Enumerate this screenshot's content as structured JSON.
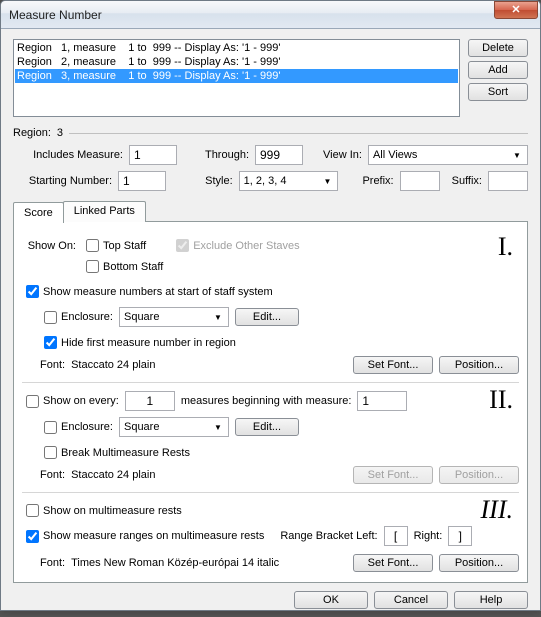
{
  "title": "Measure Number",
  "buttons": {
    "delete": "Delete",
    "add": "Add",
    "sort": "Sort",
    "ok": "OK",
    "cancel": "Cancel",
    "help": "Help",
    "edit": "Edit...",
    "setfont": "Set Font...",
    "position": "Position..."
  },
  "list": {
    "rows": [
      "Region   1, measure    1 to  999 -- Display As: '1 - 999'",
      "Region   2, measure    1 to  999 -- Display As: '1 - 999'",
      "Region   3, measure    1 to  999 -- Display As: '1 - 999'"
    ],
    "selected": 2
  },
  "region": {
    "label": "Region:",
    "value": "3"
  },
  "labels": {
    "includes": "Includes Measure:",
    "through": "Through:",
    "viewin": "View In:",
    "starting": "Starting Number:",
    "style": "Style:",
    "prefix": "Prefix:",
    "suffix": "Suffix:"
  },
  "values": {
    "includes": "1",
    "through": "999",
    "viewin": "All Views",
    "starting": "1",
    "style": "1, 2, 3, 4",
    "prefix": "",
    "suffix": ""
  },
  "tabs": {
    "score": "Score",
    "linked": "Linked Parts"
  },
  "sec1": {
    "showon": "Show On:",
    "topstaff": "Top Staff",
    "bottomstaff": "Bottom Staff",
    "exclude": "Exclude Other Staves",
    "showmeasures": "Show measure numbers at start of staff system",
    "enclosure": "Enclosure:",
    "enclosure_val": "Square",
    "hidefirst": "Hide first measure number in region",
    "font": "Font:",
    "fontval": "Staccato 24 plain",
    "preview": "I."
  },
  "sec2": {
    "showevery": "Show on every:",
    "every_val": "1",
    "measures_begin": "measures beginning with measure:",
    "begin_val": "1",
    "enclosure": "Enclosure:",
    "enclosure_val": "Square",
    "breakmm": "Break Multimeasure Rests",
    "font": "Font:",
    "fontval": "Staccato 24 plain",
    "preview": "II."
  },
  "sec3": {
    "showmm": "Show on multimeasure rests",
    "showranges": "Show measure ranges on multimeasure rests",
    "rangelabel": "Range Bracket Left:",
    "left": "[",
    "rightlabel": "Right:",
    "right": "]",
    "font": "Font:",
    "fontval": "Times New Roman Közép-európai 14 italic",
    "preview": "III."
  }
}
